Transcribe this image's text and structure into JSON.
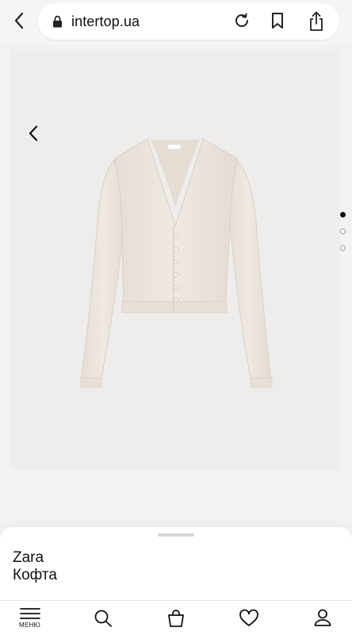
{
  "browser": {
    "url": "intertop.ua",
    "icons": [
      "back-chevron-icon",
      "lock-icon",
      "reload-icon",
      "bookmark-icon",
      "share-icon"
    ]
  },
  "product": {
    "brand": "Zara",
    "name": "Кофта",
    "image_alt": "cream ribbed cardigan",
    "carousel": {
      "total": 3,
      "active": 1
    }
  },
  "bottom_nav": {
    "menu_label": "МЕНЮ",
    "items": [
      "menu-icon",
      "search-icon",
      "bag-icon",
      "heart-icon",
      "user-icon"
    ]
  },
  "colors": {
    "sheet_bg": "#ffffff",
    "image_bg": "#eeedeb",
    "garment": "#ebe4dc",
    "active_dot": "#111111"
  }
}
